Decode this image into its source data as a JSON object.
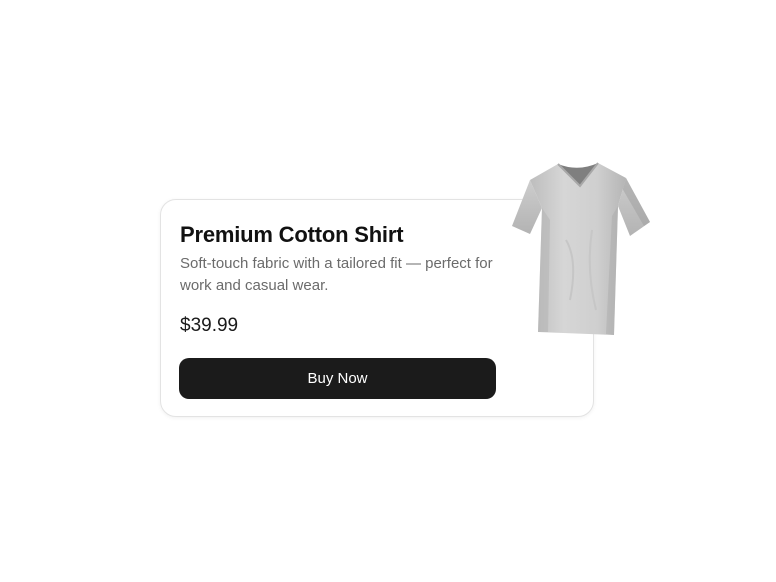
{
  "product": {
    "title": "Premium Cotton Shirt",
    "description": "Soft-touch fabric with a tailored fit — perfect for work and casual wear.",
    "price": "$39.99",
    "buy_label": "Buy Now",
    "image_icon": "tshirt-icon"
  },
  "colors": {
    "button_bg": "#1b1b1b",
    "button_text": "#ffffff",
    "card_border": "#e3e3e3",
    "shirt": "#c9c9c9"
  }
}
